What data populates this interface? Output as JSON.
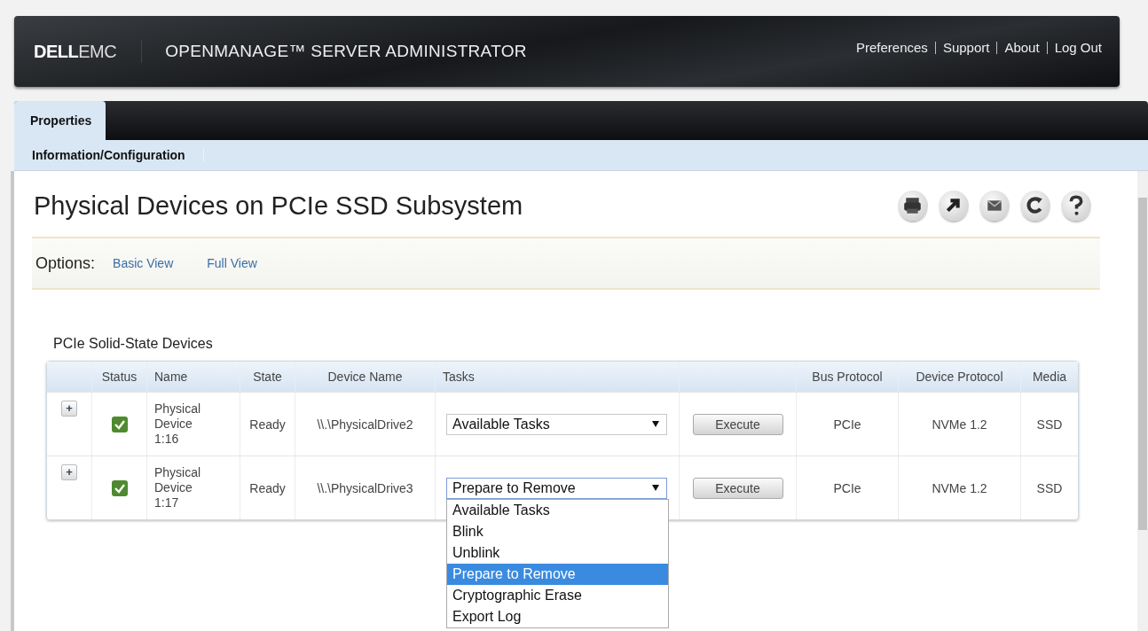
{
  "header": {
    "logo_brand": "DELL",
    "logo_suffix": "EMC",
    "app_title": "OPENMANAGE™ SERVER ADMINISTRATOR",
    "links": [
      "Preferences",
      "Support",
      "About",
      "Log Out"
    ]
  },
  "tabs": [
    {
      "label": "Properties",
      "selected": true
    }
  ],
  "subtabs": [
    {
      "label": "Information/Configuration",
      "selected": true
    }
  ],
  "page_title": "Physical Devices on PCIe SSD Subsystem",
  "options": {
    "label": "Options:",
    "links": [
      "Basic View",
      "Full View"
    ]
  },
  "section_title": "PCIe Solid-State Devices",
  "columns": {
    "status": "Status",
    "name": "Name",
    "state": "State",
    "device_name": "Device Name",
    "tasks": "Tasks",
    "bus_protocol": "Bus Protocol",
    "device_protocol": "Device Protocol",
    "media": "Media"
  },
  "rows": [
    {
      "expand": "+",
      "status_ok": true,
      "name": "Physical Device 1:16",
      "state": "Ready",
      "device_name": "\\\\.\\PhysicalDrive2",
      "task": "Available Tasks",
      "open": false,
      "execute": "Execute",
      "bus_protocol": "PCIe",
      "device_protocol": "NVMe 1.2",
      "media": "SSD"
    },
    {
      "expand": "+",
      "status_ok": true,
      "name": "Physical Device 1:17",
      "state": "Ready",
      "device_name": "\\\\.\\PhysicalDrive3",
      "task": "Prepare to Remove",
      "open": true,
      "execute": "Execute",
      "bus_protocol": "PCIe",
      "device_protocol": "NVMe 1.2",
      "media": "SSD",
      "options": [
        {
          "label": "Available Tasks",
          "selected": false
        },
        {
          "label": "Blink",
          "selected": false
        },
        {
          "label": "Unblink",
          "selected": false
        },
        {
          "label": "Prepare to Remove",
          "selected": true
        },
        {
          "label": "Cryptographic Erase",
          "selected": false
        },
        {
          "label": "Export Log",
          "selected": false
        }
      ]
    }
  ]
}
